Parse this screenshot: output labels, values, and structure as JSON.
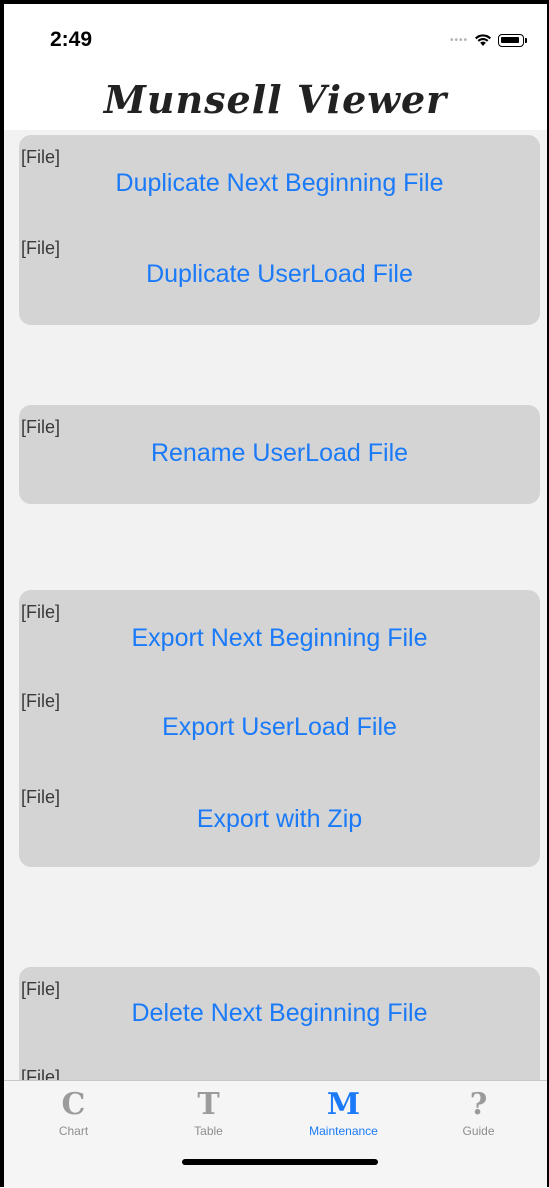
{
  "status_bar": {
    "time": "2:49",
    "icons": [
      "signal-dots-icon",
      "wifi-icon",
      "battery-icon"
    ]
  },
  "header": {
    "title": "Munsell Viewer"
  },
  "groups": [
    {
      "rows": [
        {
          "tag": "[File]",
          "action": "Duplicate Next Beginning File"
        },
        {
          "tag": "[File]",
          "action": "Duplicate UserLoad File"
        }
      ]
    },
    {
      "rows": [
        {
          "tag": "[File]",
          "action": "Rename UserLoad File"
        }
      ]
    },
    {
      "rows": [
        {
          "tag": "[File]",
          "action": "Export Next Beginning File"
        },
        {
          "tag": "[File]",
          "action": "Export UserLoad File"
        },
        {
          "tag": "[File]",
          "action": "Export with Zip"
        }
      ]
    },
    {
      "rows": [
        {
          "tag": "[File]",
          "action": "Delete Next Beginning File"
        },
        {
          "tag": "[File]",
          "action": ""
        }
      ]
    }
  ],
  "tabbar": {
    "tabs": [
      {
        "glyph": "C",
        "label": "Chart"
      },
      {
        "glyph": "T",
        "label": "Table"
      },
      {
        "glyph": "M",
        "label": "Maintenance"
      },
      {
        "glyph": "?",
        "label": "Guide"
      }
    ],
    "active_index": 2
  },
  "colors": {
    "accent": "#1a7af8",
    "group_background": "#d4d4d4",
    "content_background": "#f2f2f2",
    "tag_text": "#3a3a3a",
    "inactive_tab": "#9b9b9b"
  }
}
